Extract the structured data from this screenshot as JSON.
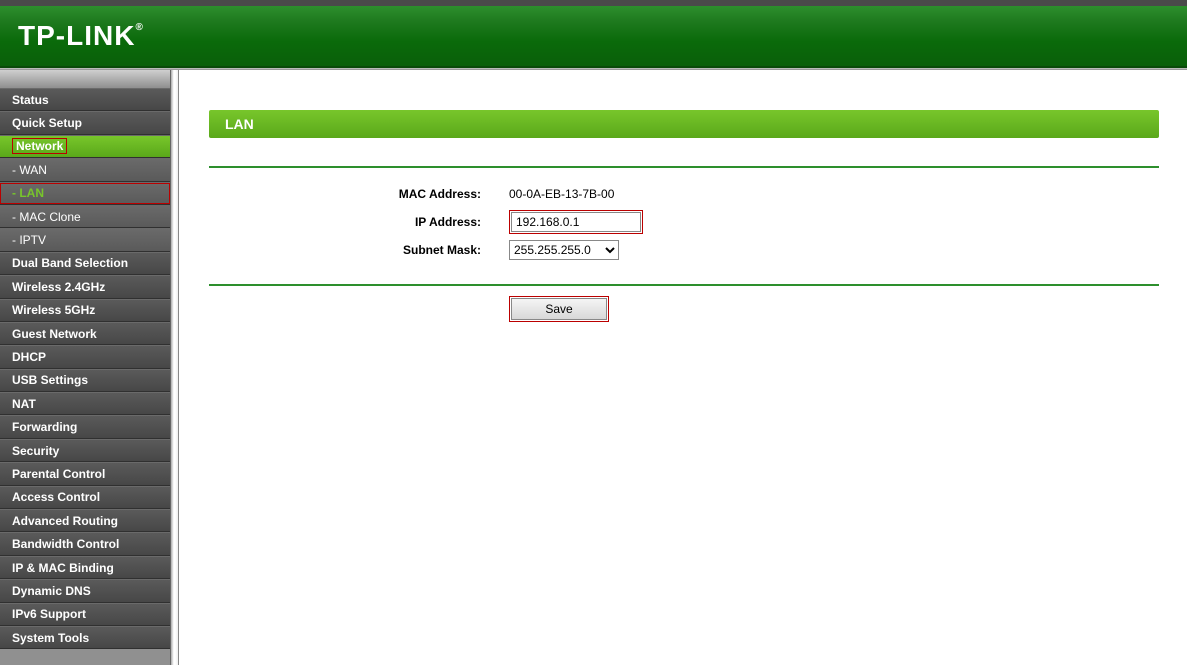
{
  "brand": "TP-LINK",
  "sidebar": {
    "items": [
      {
        "label": "Status"
      },
      {
        "label": "Quick Setup"
      },
      {
        "label": "Network"
      },
      {
        "label": "- WAN"
      },
      {
        "label": "- LAN"
      },
      {
        "label": "- MAC Clone"
      },
      {
        "label": "- IPTV"
      },
      {
        "label": "Dual Band Selection"
      },
      {
        "label": "Wireless 2.4GHz"
      },
      {
        "label": "Wireless 5GHz"
      },
      {
        "label": "Guest Network"
      },
      {
        "label": "DHCP"
      },
      {
        "label": "USB Settings"
      },
      {
        "label": "NAT"
      },
      {
        "label": "Forwarding"
      },
      {
        "label": "Security"
      },
      {
        "label": "Parental Control"
      },
      {
        "label": "Access Control"
      },
      {
        "label": "Advanced Routing"
      },
      {
        "label": "Bandwidth Control"
      },
      {
        "label": "IP & MAC Binding"
      },
      {
        "label": "Dynamic DNS"
      },
      {
        "label": "IPv6 Support"
      },
      {
        "label": "System Tools"
      }
    ]
  },
  "page": {
    "title": "LAN",
    "mac_label": "MAC Address:",
    "mac_value": "00-0A-EB-13-7B-00",
    "ip_label": "IP Address:",
    "ip_value": "192.168.0.1",
    "mask_label": "Subnet Mask:",
    "mask_value": "255.255.255.0",
    "save_label": "Save"
  }
}
